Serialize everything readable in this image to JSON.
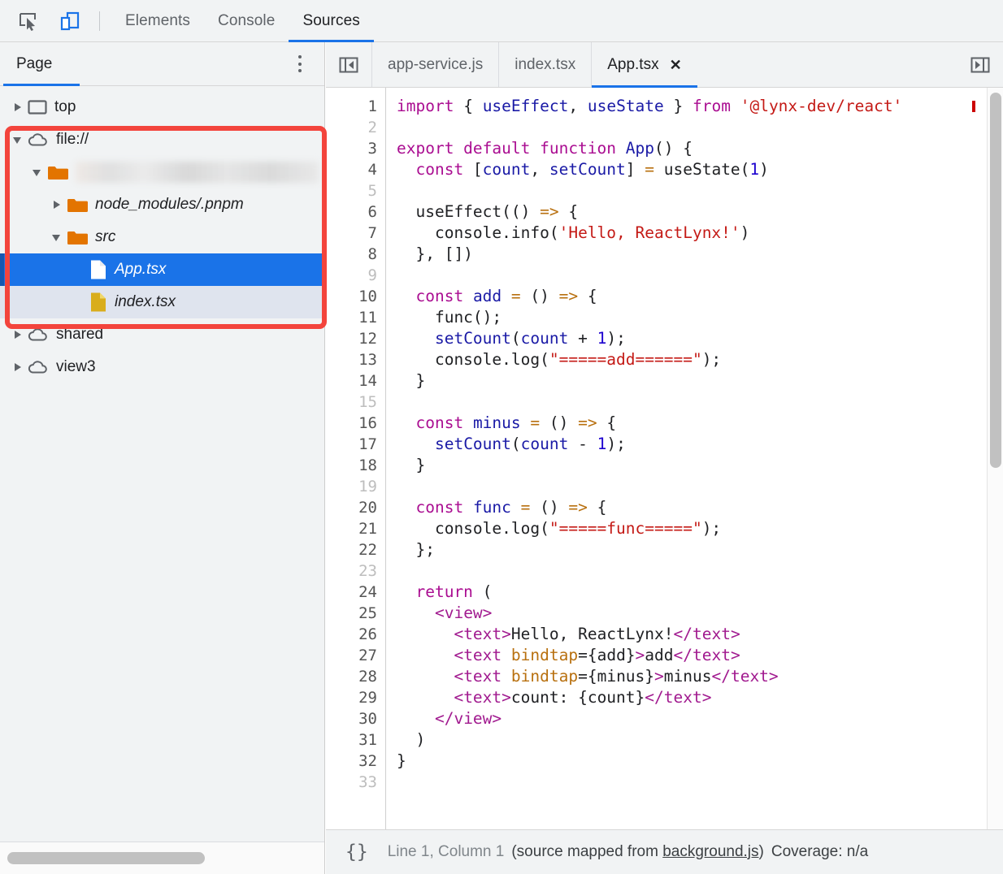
{
  "toolbar": {
    "inspect_icon": "inspect-element-icon",
    "device_icon": "device-toolbar-icon",
    "tabs": [
      {
        "label": "Elements",
        "active": false
      },
      {
        "label": "Console",
        "active": false
      },
      {
        "label": "Sources",
        "active": true
      }
    ]
  },
  "navigator": {
    "header_title": "Page",
    "more_icon": "more-options-icon",
    "tree": [
      {
        "label": "top",
        "icon": "frame-icon",
        "twisty": "closed",
        "indent": 14,
        "italic": false,
        "state": "normal"
      },
      {
        "label": "file://",
        "icon": "cloud-icon",
        "twisty": "open",
        "indent": 14,
        "italic": false,
        "state": "normal"
      },
      {
        "label": "",
        "icon": "folder-icon",
        "twisty": "open",
        "indent": 38,
        "italic": true,
        "state": "blurred"
      },
      {
        "label": "node_modules/.pnpm",
        "icon": "folder-icon",
        "twisty": "closed",
        "indent": 62,
        "italic": true,
        "state": "normal"
      },
      {
        "label": "src",
        "icon": "folder-icon",
        "twisty": "open",
        "indent": 62,
        "italic": true,
        "state": "normal"
      },
      {
        "label": "App.tsx",
        "icon": "file-tsx-icon",
        "twisty": "none",
        "indent": 110,
        "italic": true,
        "state": "selected"
      },
      {
        "label": "index.tsx",
        "icon": "file-yellow-icon",
        "twisty": "none",
        "indent": 110,
        "italic": true,
        "state": "hovered"
      },
      {
        "label": "shared",
        "icon": "cloud-icon",
        "twisty": "closed",
        "indent": 14,
        "italic": false,
        "state": "normal"
      },
      {
        "label": "view3",
        "icon": "cloud-icon",
        "twisty": "closed",
        "indent": 14,
        "italic": false,
        "state": "normal"
      }
    ],
    "annotation": {
      "shape": "rectangle",
      "color": "#f3443c"
    },
    "scrollbar": "horizontal-scrollbar"
  },
  "editor": {
    "prev_icon": "scroll-tabs-left-icon",
    "next_icon": "scroll-tabs-right-icon",
    "tabs": [
      {
        "label": "app-service.js",
        "active": false,
        "closable": false
      },
      {
        "label": "index.tsx",
        "active": false,
        "closable": false
      },
      {
        "label": "App.tsx",
        "active": true,
        "closable": true
      }
    ],
    "close_glyph": "✕",
    "lines": [
      {
        "n": "1",
        "tokens": [
          {
            "t": "import",
            "c": "kw"
          },
          {
            "t": " { ",
            "c": "pl"
          },
          {
            "t": "useEffect",
            "c": "id"
          },
          {
            "t": ", ",
            "c": "pl"
          },
          {
            "t": "useState",
            "c": "id"
          },
          {
            "t": " } ",
            "c": "pl"
          },
          {
            "t": "from",
            "c": "kw"
          },
          {
            "t": " ",
            "c": "pl"
          },
          {
            "t": "'@lynx-dev/react'",
            "c": "str"
          }
        ]
      },
      {
        "n": "2",
        "tokens": []
      },
      {
        "n": "3",
        "tokens": [
          {
            "t": "export default function",
            "c": "kw"
          },
          {
            "t": " ",
            "c": "pl"
          },
          {
            "t": "App",
            "c": "id"
          },
          {
            "t": "() {",
            "c": "pl"
          }
        ]
      },
      {
        "n": "4",
        "tokens": [
          {
            "t": "  ",
            "c": "pl"
          },
          {
            "t": "const",
            "c": "kw"
          },
          {
            "t": " [",
            "c": "pl"
          },
          {
            "t": "count",
            "c": "id"
          },
          {
            "t": ", ",
            "c": "pl"
          },
          {
            "t": "setCount",
            "c": "id"
          },
          {
            "t": "] ",
            "c": "pl"
          },
          {
            "t": "=",
            "c": "op"
          },
          {
            "t": " useState(",
            "c": "pl"
          },
          {
            "t": "1",
            "c": "num"
          },
          {
            "t": ")",
            "c": "pl"
          }
        ]
      },
      {
        "n": "5",
        "tokens": []
      },
      {
        "n": "6",
        "tokens": [
          {
            "t": "  useEffect(() ",
            "c": "pl"
          },
          {
            "t": "=>",
            "c": "op"
          },
          {
            "t": " {",
            "c": "pl"
          }
        ]
      },
      {
        "n": "7",
        "tokens": [
          {
            "t": "    console.info(",
            "c": "pl"
          },
          {
            "t": "'Hello, ReactLynx!'",
            "c": "str"
          },
          {
            "t": ")",
            "c": "pl"
          }
        ]
      },
      {
        "n": "8",
        "tokens": [
          {
            "t": "  }, [])",
            "c": "pl"
          }
        ]
      },
      {
        "n": "9",
        "tokens": []
      },
      {
        "n": "10",
        "tokens": [
          {
            "t": "  ",
            "c": "pl"
          },
          {
            "t": "const",
            "c": "kw"
          },
          {
            "t": " ",
            "c": "pl"
          },
          {
            "t": "add",
            "c": "id"
          },
          {
            "t": " ",
            "c": "pl"
          },
          {
            "t": "=",
            "c": "op"
          },
          {
            "t": " () ",
            "c": "pl"
          },
          {
            "t": "=>",
            "c": "op"
          },
          {
            "t": " {",
            "c": "pl"
          }
        ]
      },
      {
        "n": "11",
        "tokens": [
          {
            "t": "    func();",
            "c": "pl"
          }
        ]
      },
      {
        "n": "12",
        "tokens": [
          {
            "t": "    ",
            "c": "pl"
          },
          {
            "t": "setCount",
            "c": "id"
          },
          {
            "t": "(",
            "c": "pl"
          },
          {
            "t": "count",
            "c": "id"
          },
          {
            "t": " + ",
            "c": "pl"
          },
          {
            "t": "1",
            "c": "num"
          },
          {
            "t": ");",
            "c": "pl"
          }
        ]
      },
      {
        "n": "13",
        "tokens": [
          {
            "t": "    console.log(",
            "c": "pl"
          },
          {
            "t": "\"=====add======\"",
            "c": "str"
          },
          {
            "t": ");",
            "c": "pl"
          }
        ]
      },
      {
        "n": "14",
        "tokens": [
          {
            "t": "  }",
            "c": "pl"
          }
        ]
      },
      {
        "n": "15",
        "tokens": []
      },
      {
        "n": "16",
        "tokens": [
          {
            "t": "  ",
            "c": "pl"
          },
          {
            "t": "const",
            "c": "kw"
          },
          {
            "t": " ",
            "c": "pl"
          },
          {
            "t": "minus",
            "c": "id"
          },
          {
            "t": " ",
            "c": "pl"
          },
          {
            "t": "=",
            "c": "op"
          },
          {
            "t": " () ",
            "c": "pl"
          },
          {
            "t": "=>",
            "c": "op"
          },
          {
            "t": " {",
            "c": "pl"
          }
        ]
      },
      {
        "n": "17",
        "tokens": [
          {
            "t": "    ",
            "c": "pl"
          },
          {
            "t": "setCount",
            "c": "id"
          },
          {
            "t": "(",
            "c": "pl"
          },
          {
            "t": "count",
            "c": "id"
          },
          {
            "t": " - ",
            "c": "pl"
          },
          {
            "t": "1",
            "c": "num"
          },
          {
            "t": ");",
            "c": "pl"
          }
        ]
      },
      {
        "n": "18",
        "tokens": [
          {
            "t": "  }",
            "c": "pl"
          }
        ]
      },
      {
        "n": "19",
        "tokens": []
      },
      {
        "n": "20",
        "tokens": [
          {
            "t": "  ",
            "c": "pl"
          },
          {
            "t": "const",
            "c": "kw"
          },
          {
            "t": " ",
            "c": "pl"
          },
          {
            "t": "func",
            "c": "id"
          },
          {
            "t": " ",
            "c": "pl"
          },
          {
            "t": "=",
            "c": "op"
          },
          {
            "t": " () ",
            "c": "pl"
          },
          {
            "t": "=>",
            "c": "op"
          },
          {
            "t": " {",
            "c": "pl"
          }
        ]
      },
      {
        "n": "21",
        "tokens": [
          {
            "t": "    console.log(",
            "c": "pl"
          },
          {
            "t": "\"=====func=====\"",
            "c": "str"
          },
          {
            "t": ");",
            "c": "pl"
          }
        ]
      },
      {
        "n": "22",
        "tokens": [
          {
            "t": "  };",
            "c": "pl"
          }
        ]
      },
      {
        "n": "23",
        "tokens": []
      },
      {
        "n": "24",
        "tokens": [
          {
            "t": "  ",
            "c": "pl"
          },
          {
            "t": "return",
            "c": "kw"
          },
          {
            "t": " (",
            "c": "pl"
          }
        ]
      },
      {
        "n": "25",
        "tokens": [
          {
            "t": "    ",
            "c": "pl"
          },
          {
            "t": "<view>",
            "c": "tag"
          }
        ]
      },
      {
        "n": "26",
        "tokens": [
          {
            "t": "      ",
            "c": "pl"
          },
          {
            "t": "<text>",
            "c": "tag"
          },
          {
            "t": "Hello, ReactLynx!",
            "c": "pl"
          },
          {
            "t": "</text>",
            "c": "tag"
          }
        ]
      },
      {
        "n": "27",
        "tokens": [
          {
            "t": "      ",
            "c": "pl"
          },
          {
            "t": "<text",
            "c": "tag"
          },
          {
            "t": " ",
            "c": "pl"
          },
          {
            "t": "bindtap",
            "c": "attr"
          },
          {
            "t": "=",
            "c": "pl"
          },
          {
            "t": "{add}",
            "c": "pl"
          },
          {
            "t": ">",
            "c": "tag"
          },
          {
            "t": "add",
            "c": "pl"
          },
          {
            "t": "</text>",
            "c": "tag"
          }
        ]
      },
      {
        "n": "28",
        "tokens": [
          {
            "t": "      ",
            "c": "pl"
          },
          {
            "t": "<text",
            "c": "tag"
          },
          {
            "t": " ",
            "c": "pl"
          },
          {
            "t": "bindtap",
            "c": "attr"
          },
          {
            "t": "=",
            "c": "pl"
          },
          {
            "t": "{minus}",
            "c": "pl"
          },
          {
            "t": ">",
            "c": "tag"
          },
          {
            "t": "minus",
            "c": "pl"
          },
          {
            "t": "</text>",
            "c": "tag"
          }
        ]
      },
      {
        "n": "29",
        "tokens": [
          {
            "t": "      ",
            "c": "pl"
          },
          {
            "t": "<text>",
            "c": "tag"
          },
          {
            "t": "count: {count}",
            "c": "pl"
          },
          {
            "t": "</text>",
            "c": "tag"
          }
        ]
      },
      {
        "n": "30",
        "tokens": [
          {
            "t": "    ",
            "c": "pl"
          },
          {
            "t": "</view>",
            "c": "tag"
          }
        ]
      },
      {
        "n": "31",
        "tokens": [
          {
            "t": "  )",
            "c": "pl"
          }
        ]
      },
      {
        "n": "32",
        "tokens": [
          {
            "t": "}",
            "c": "pl"
          }
        ]
      },
      {
        "n": "33",
        "tokens": []
      }
    ],
    "scrollbar": "vertical-scrollbar"
  },
  "statusbar": {
    "format_icon": "{}",
    "position": "Line 1, Column 1",
    "source_map_prefix": "(source mapped from ",
    "source_map_link": "background.js",
    "source_map_suffix": ")",
    "coverage": "Coverage: n/a"
  },
  "colors": {
    "accent": "#1a73e8",
    "annotation": "#f3443c",
    "folder": "#e37400",
    "file_yellow": "#d9ad1c",
    "panel_bg": "#f1f3f4"
  }
}
